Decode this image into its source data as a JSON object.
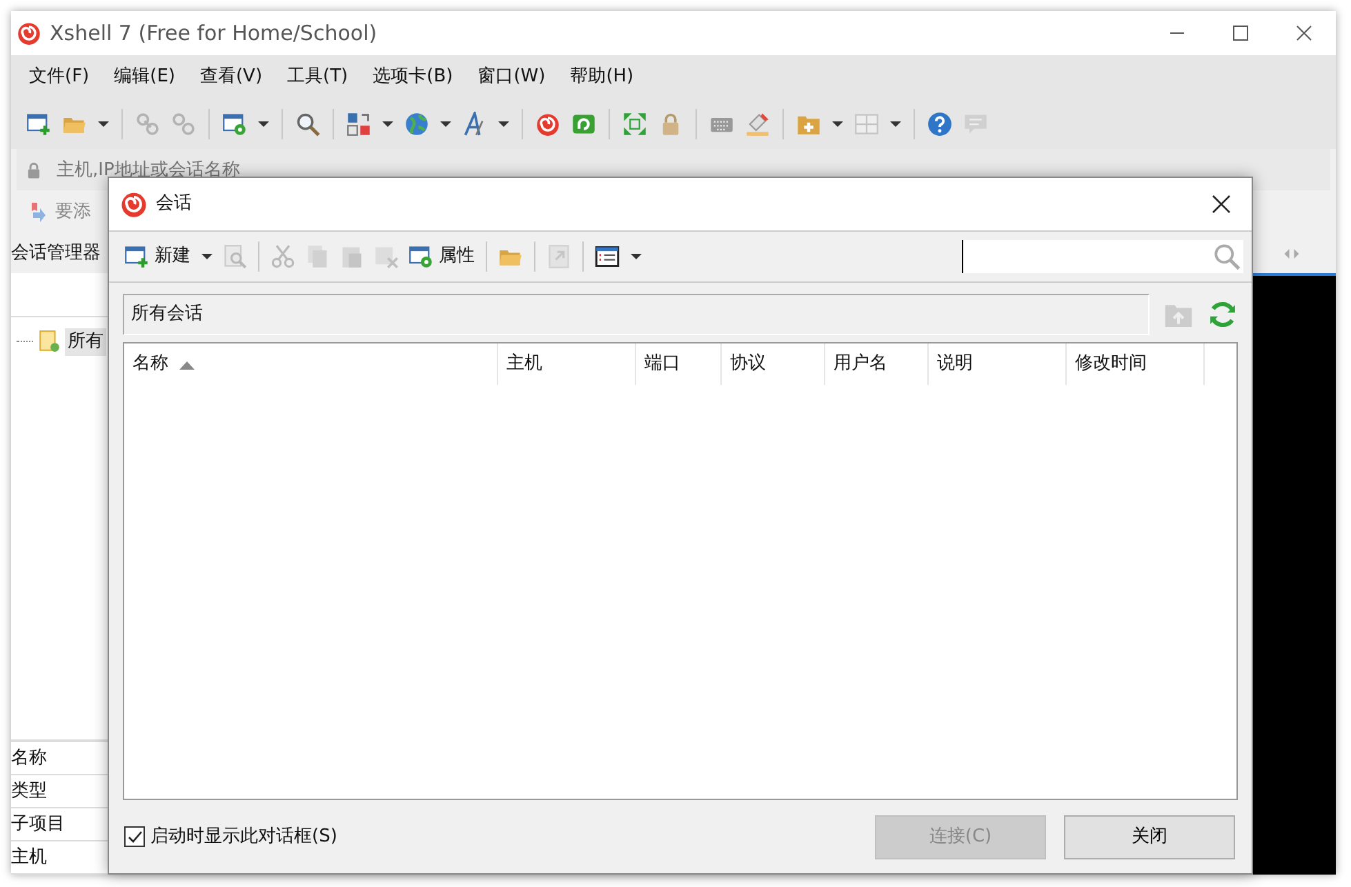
{
  "app": {
    "title": "Xshell 7 (Free for Home/School)"
  },
  "menu": [
    "文件(F)",
    "编辑(E)",
    "查看(V)",
    "工具(T)",
    "选项卡(B)",
    "窗口(W)",
    "帮助(H)"
  ],
  "toolbar": [
    {
      "kind": "button",
      "disabled": false,
      "dropdown": false
    },
    {
      "kind": "button",
      "disabled": false,
      "dropdown": true
    },
    {
      "kind": "separator"
    },
    {
      "kind": "button",
      "disabled": true,
      "dropdown": false
    },
    {
      "kind": "button",
      "disabled": true,
      "dropdown": false
    },
    {
      "kind": "separator"
    },
    {
      "kind": "button",
      "disabled": false,
      "dropdown": true
    },
    {
      "kind": "separator"
    },
    {
      "kind": "button",
      "disabled": false,
      "dropdown": false
    },
    {
      "kind": "separator"
    },
    {
      "kind": "button",
      "disabled": false,
      "dropdown": true
    },
    {
      "kind": "button",
      "disabled": false,
      "dropdown": true
    },
    {
      "kind": "button",
      "disabled": false,
      "dropdown": true
    },
    {
      "kind": "separator"
    },
    {
      "kind": "button",
      "disabled": false,
      "dropdown": false
    },
    {
      "kind": "button",
      "disabled": false,
      "dropdown": false
    },
    {
      "kind": "separator"
    },
    {
      "kind": "button",
      "disabled": false,
      "dropdown": false
    },
    {
      "kind": "button",
      "disabled": false,
      "dropdown": false
    },
    {
      "kind": "separator"
    },
    {
      "kind": "button",
      "disabled": false,
      "dropdown": false
    },
    {
      "kind": "button",
      "disabled": false,
      "dropdown": false
    },
    {
      "kind": "separator"
    },
    {
      "kind": "button",
      "disabled": false,
      "dropdown": true
    },
    {
      "kind": "button",
      "disabled": true,
      "dropdown": true
    },
    {
      "kind": "separator"
    },
    {
      "kind": "button",
      "disabled": false,
      "dropdown": false
    },
    {
      "kind": "button",
      "disabled": true,
      "dropdown": false
    }
  ],
  "address_bar": {
    "placeholder": "主机,IP地址或会话名称"
  },
  "links_bar": {
    "text": "要添"
  },
  "session_manager": {
    "title": "会话管理器",
    "tree": [
      {
        "label": "所有",
        "selected": true
      }
    ],
    "properties": [
      "名称",
      "类型",
      "子项目",
      "主机"
    ]
  },
  "dialog": {
    "title": "会话",
    "toolbar": [
      {
        "kind": "button",
        "label": "新建",
        "disabled": false,
        "dropdown": true
      },
      {
        "kind": "button",
        "disabled": true,
        "dropdown": false
      },
      {
        "kind": "separator"
      },
      {
        "kind": "button",
        "disabled": true,
        "dropdown": false
      },
      {
        "kind": "button",
        "disabled": true,
        "dropdown": false
      },
      {
        "kind": "button",
        "disabled": true,
        "dropdown": false
      },
      {
        "kind": "button",
        "disabled": true,
        "dropdown": false
      },
      {
        "kind": "button",
        "label": "属性",
        "disabled": false,
        "dropdown": false
      },
      {
        "kind": "separator"
      },
      {
        "kind": "button",
        "disabled": false,
        "dropdown": false
      },
      {
        "kind": "separator"
      },
      {
        "kind": "button",
        "disabled": true,
        "dropdown": false
      },
      {
        "kind": "separator"
      },
      {
        "kind": "button",
        "disabled": false,
        "dropdown": true
      }
    ],
    "path": "所有会话",
    "columns": [
      {
        "label": "名称",
        "sorted": true
      },
      {
        "label": "主机",
        "sorted": false
      },
      {
        "label": "端口",
        "sorted": false
      },
      {
        "label": "协议",
        "sorted": false
      },
      {
        "label": "用户名",
        "sorted": false
      },
      {
        "label": "说明",
        "sorted": false
      },
      {
        "label": "修改时间",
        "sorted": false
      }
    ],
    "show_on_startup": {
      "label": "启动时显示此对话框(S)",
      "checked": true
    },
    "buttons": [
      {
        "label": "连接(C)",
        "disabled": true
      },
      {
        "label": "关闭",
        "disabled": false
      }
    ]
  }
}
